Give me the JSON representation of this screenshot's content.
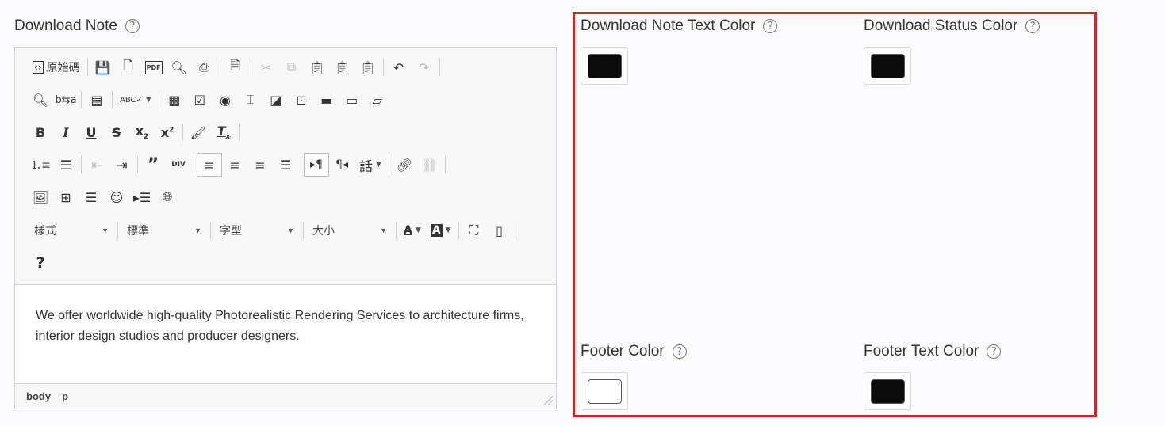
{
  "download_note": {
    "label": "Download Note",
    "toolbar": {
      "source_label": "原始碼",
      "style_combo": "樣式",
      "format_combo": "標準",
      "font_combo": "字型",
      "size_combo": "大小",
      "language_label": "話",
      "div_label": "DIV"
    },
    "content": "We offer worldwide high-quality Photorealistic Rendering Services to architecture firms, interior design studios and producer designers.",
    "path": [
      "body",
      "p"
    ]
  },
  "colors": {
    "note_text": {
      "label": "Download Note Text Color",
      "value": "#0a0a0a"
    },
    "status": {
      "label": "Download Status Color",
      "value": "#0a0a0a"
    },
    "footer": {
      "label": "Footer Color",
      "value": "#ffffff"
    },
    "footer_text": {
      "label": "Footer Text Color",
      "value": "#0a0a0a"
    }
  },
  "highlight_color": "#e31b23"
}
